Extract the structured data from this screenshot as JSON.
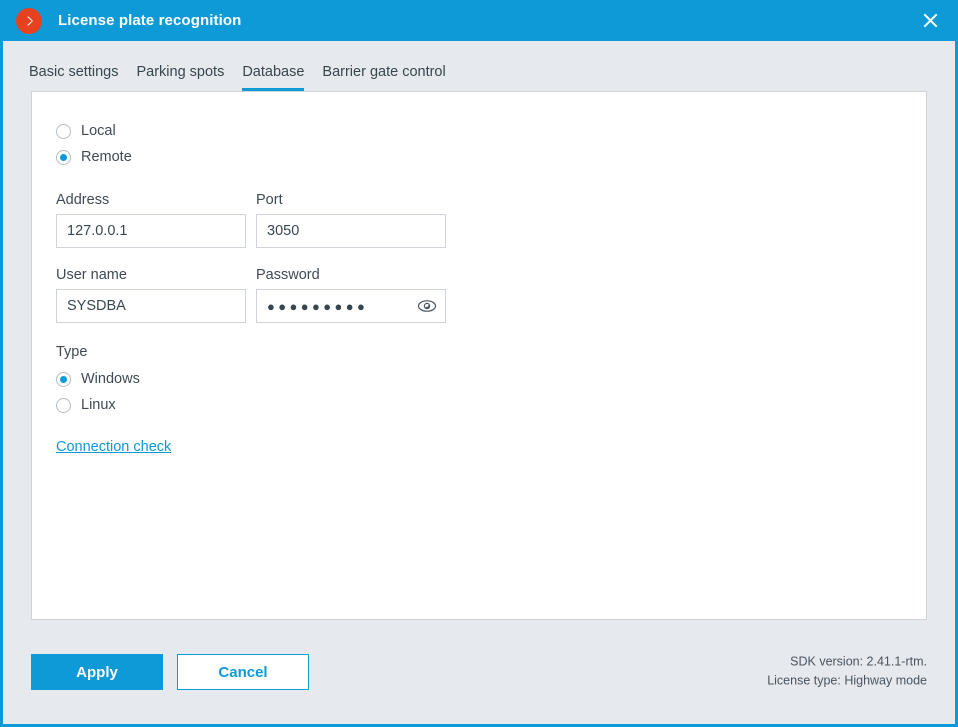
{
  "window": {
    "title": "License plate recognition",
    "logo_icon": "chevron-right-circle-icon",
    "close_icon": "close-icon",
    "accent_color": "#0d9ad6",
    "logo_color": "#e8411f"
  },
  "tabs": [
    {
      "label": "Basic settings",
      "active": false
    },
    {
      "label": "Parking spots",
      "active": false
    },
    {
      "label": "Database",
      "active": true
    },
    {
      "label": "Barrier gate control",
      "active": false
    }
  ],
  "form": {
    "location_options": [
      {
        "label": "Local",
        "selected": false
      },
      {
        "label": "Remote",
        "selected": true
      }
    ],
    "address": {
      "label": "Address",
      "value": "127.0.0.1",
      "placeholder": ""
    },
    "port": {
      "label": "Port",
      "value": "3050",
      "placeholder": ""
    },
    "user_name": {
      "label": "User name",
      "value": "SYSDBA",
      "placeholder": ""
    },
    "password": {
      "label": "Password",
      "masked_value": "●●●●●●●●●",
      "reveal_icon": "eye-icon"
    },
    "type": {
      "label": "Type",
      "options": [
        {
          "label": "Windows",
          "selected": true
        },
        {
          "label": "Linux",
          "selected": false
        }
      ]
    },
    "connection_check_link": "Connection check"
  },
  "footer": {
    "apply_label": "Apply",
    "cancel_label": "Cancel",
    "sdk_version": "SDK version: 2.41.1-rtm.",
    "license_type": "License type: Highway mode"
  }
}
